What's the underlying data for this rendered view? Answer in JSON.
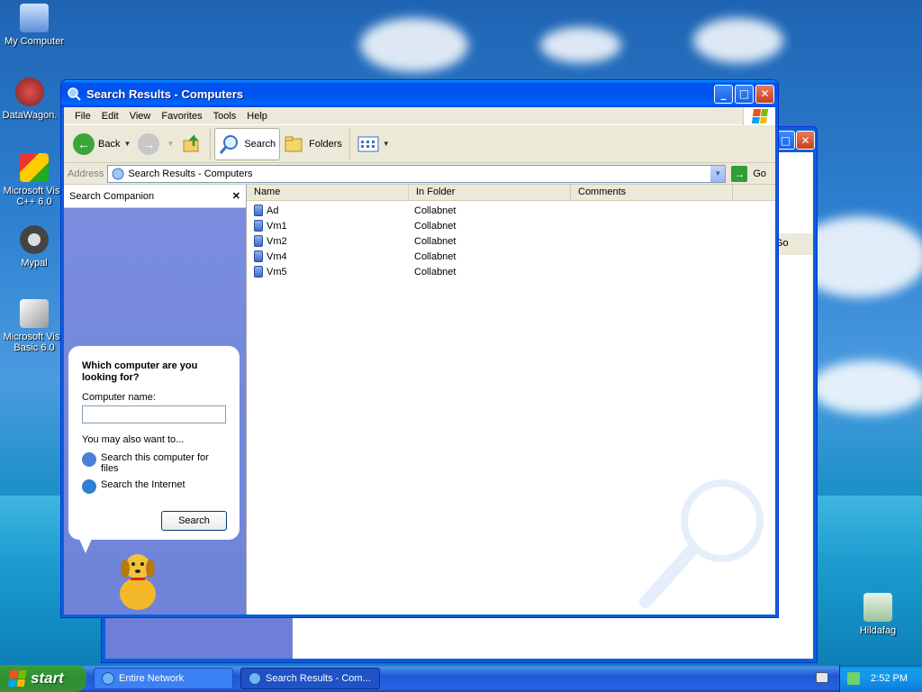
{
  "desktop": {
    "icons": [
      {
        "label": "My Computer"
      },
      {
        "label": "DataWagon."
      },
      {
        "label": "Microsoft Visu C++ 6.0"
      },
      {
        "label": "Mypal"
      },
      {
        "label": "Microsoft Visu Basic 6.0"
      },
      {
        "label": "Hildafag"
      }
    ]
  },
  "bg_window": {
    "go_label": "Go"
  },
  "window": {
    "title": "Search Results - Computers",
    "menu": [
      "File",
      "Edit",
      "View",
      "Favorites",
      "Tools",
      "Help"
    ],
    "toolbar": {
      "back": "Back",
      "search": "Search",
      "folders": "Folders"
    },
    "address": {
      "label": "Address",
      "value": "Search Results - Computers",
      "go": "Go"
    },
    "companion": {
      "title": "Search Companion",
      "close": "✕",
      "question": "Which computer are you looking for?",
      "name_label": "Computer name:",
      "name_value": "",
      "also_label": "You may also want to...",
      "option1": "Search this computer for files",
      "option2": "Search the Internet",
      "search_button": "Search"
    },
    "columns": [
      "Name",
      "In Folder",
      "Comments"
    ],
    "rows": [
      {
        "name": "Ad",
        "folder": "Collabnet"
      },
      {
        "name": "Vm1",
        "folder": "Collabnet"
      },
      {
        "name": "Vm2",
        "folder": "Collabnet"
      },
      {
        "name": "Vm4",
        "folder": "Collabnet"
      },
      {
        "name": "Vm5",
        "folder": "Collabnet"
      }
    ]
  },
  "taskbar": {
    "start": "start",
    "tasks": [
      {
        "label": "Entire Network"
      },
      {
        "label": "Search Results - Com..."
      }
    ],
    "clock": "2:52 PM"
  },
  "colors": {
    "title_blue": "#0050ee",
    "companion_blue": "#7a8ddf",
    "start_green": "#2f8f2f"
  }
}
